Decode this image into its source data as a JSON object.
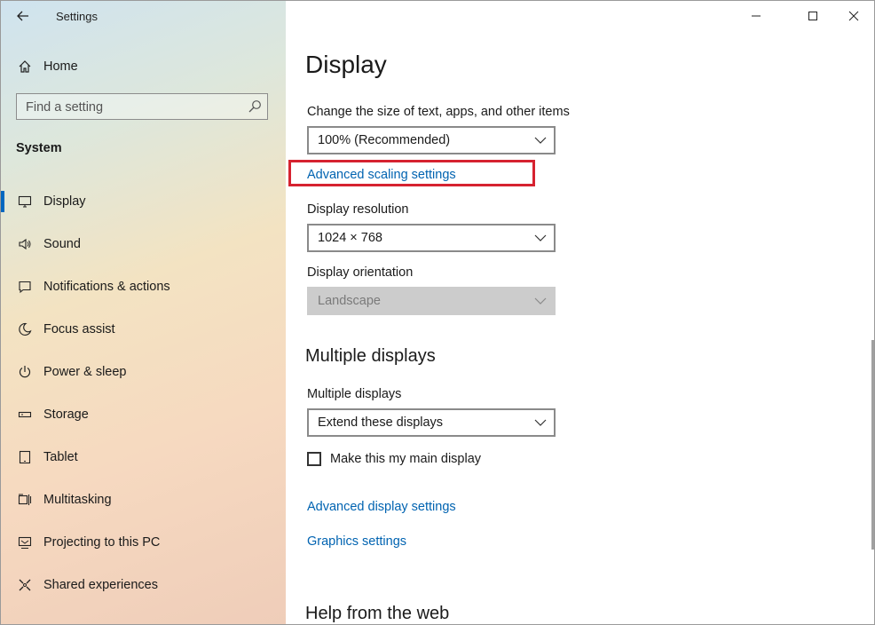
{
  "window": {
    "app_title": "Settings",
    "controls": [
      "minimize",
      "maximize",
      "close"
    ]
  },
  "sidebar": {
    "home_label": "Home",
    "search": {
      "placeholder": "Find a setting",
      "value": ""
    },
    "section_label": "System",
    "items": [
      {
        "label": "Display",
        "icon": "monitor-icon",
        "selected": true
      },
      {
        "label": "Sound",
        "icon": "speaker-icon",
        "selected": false
      },
      {
        "label": "Notifications & actions",
        "icon": "notification-icon",
        "selected": false
      },
      {
        "label": "Focus assist",
        "icon": "moon-icon",
        "selected": false
      },
      {
        "label": "Power & sleep",
        "icon": "power-icon",
        "selected": false
      },
      {
        "label": "Storage",
        "icon": "storage-icon",
        "selected": false
      },
      {
        "label": "Tablet",
        "icon": "tablet-icon",
        "selected": false
      },
      {
        "label": "Multitasking",
        "icon": "multitasking-icon",
        "selected": false
      },
      {
        "label": "Projecting to this PC",
        "icon": "projecting-icon",
        "selected": false
      },
      {
        "label": "Shared experiences",
        "icon": "shared-icon",
        "selected": false
      }
    ]
  },
  "main": {
    "title": "Display",
    "scale": {
      "label": "Change the size of text, apps, and other items",
      "value": "100% (Recommended)",
      "advanced_link": "Advanced scaling settings"
    },
    "resolution": {
      "label": "Display resolution",
      "value": "1024 × 768"
    },
    "orientation": {
      "label": "Display orientation",
      "value": "Landscape",
      "disabled": true
    },
    "multiple_displays": {
      "section_title": "Multiple displays",
      "label": "Multiple displays",
      "value": "Extend these displays",
      "checkbox_label": "Make this my main display",
      "checked": false
    },
    "links": {
      "advanced_display": "Advanced display settings",
      "graphics": "Graphics settings"
    },
    "help_title": "Help from the web"
  },
  "colors": {
    "accent": "#0067c0",
    "link": "#0063b1",
    "highlight": "#d62230"
  }
}
